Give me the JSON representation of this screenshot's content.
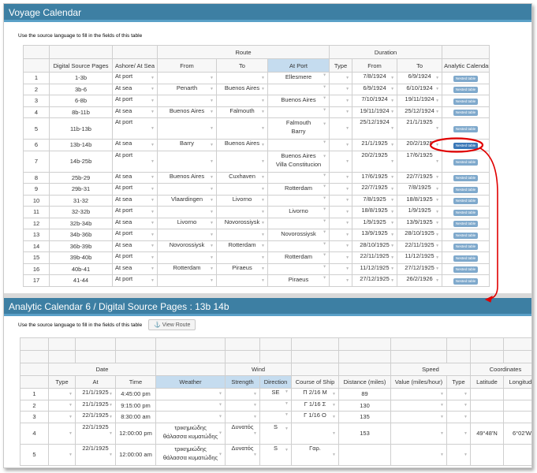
{
  "voyage": {
    "title": "Voyage Calendar",
    "note": "Use the source language to fill in the fields of this table",
    "group_headers": {
      "route": "Route",
      "duration": "Duration"
    },
    "col_headers": [
      "",
      "Digital Source Pages",
      "Ashore/ At Sea",
      "From",
      "To",
      "At Port",
      "Type",
      "From",
      "To",
      "Analytic Calendar"
    ],
    "nested_label": "Nested table",
    "rows": [
      {
        "n": "1",
        "pages": "1-3b",
        "ashore": "At port",
        "from": "",
        "to": "",
        "port": "Ellesmere",
        "dfrom": "7/8/1924",
        "dto": "6/9/1924"
      },
      {
        "n": "2",
        "pages": "3b-6",
        "ashore": "At sea",
        "from": "Penarth",
        "to": "Buenos Aires",
        "port": "",
        "dfrom": "6/9/1924",
        "dto": "6/10/1924"
      },
      {
        "n": "3",
        "pages": "6-8b",
        "ashore": "At port",
        "from": "",
        "to": "",
        "port": "Buenos Aires",
        "dfrom": "7/10/1924",
        "dto": "19/11/1924"
      },
      {
        "n": "4",
        "pages": "8b-11b",
        "ashore": "At sea",
        "from": "Buenos Aires",
        "to": "Falmouth",
        "port": "",
        "dfrom": "19/11/1924",
        "dto": "25/12/1924"
      },
      {
        "n": "5",
        "pages": "11b-13b",
        "ashore": "At port",
        "from": "",
        "to": "",
        "port": "Falmouth",
        "port2": "Barry",
        "dfrom": "25/12/1924",
        "dto": "21/1/1925"
      },
      {
        "n": "6",
        "pages": "13b-14b",
        "ashore": "At sea",
        "from": "Barry",
        "to": "Buenos Aires",
        "port": "",
        "dfrom": "21/1/1925",
        "dto": "20/2/1925",
        "active": true
      },
      {
        "n": "7",
        "pages": "14b-25b",
        "ashore": "At port",
        "from": "",
        "to": "",
        "port": "Buenos Aires",
        "port2": "Villa Constitucion",
        "dfrom": "20/2/1925",
        "dto": "17/6/1925"
      },
      {
        "n": "8",
        "pages": "25b-29",
        "ashore": "At sea",
        "from": "Buenos Aires",
        "to": "Cuxhaven",
        "port": "",
        "dfrom": "17/6/1925",
        "dto": "22/7/1925"
      },
      {
        "n": "9",
        "pages": "29b-31",
        "ashore": "At port",
        "from": "",
        "to": "",
        "port": "Rotterdam",
        "dfrom": "22/7/1925",
        "dto": "7/8/1925"
      },
      {
        "n": "10",
        "pages": "31-32",
        "ashore": "At sea",
        "from": "Vlaardingen",
        "to": "Livorno",
        "port": "",
        "dfrom": "7/8/1925",
        "dto": "18/8/1925"
      },
      {
        "n": "11",
        "pages": "32-32b",
        "ashore": "At port",
        "from": "",
        "to": "",
        "port": "Livorno",
        "dfrom": "18/8/1925",
        "dto": "1/9/1925"
      },
      {
        "n": "12",
        "pages": "32b-34b",
        "ashore": "At sea",
        "from": "Livorno",
        "to": "Novorossiysk",
        "port": "",
        "dfrom": "1/9/1925",
        "dto": "13/9/1925"
      },
      {
        "n": "13",
        "pages": "34b-36b",
        "ashore": "At port",
        "from": "",
        "to": "",
        "port": "Novorossiysk",
        "dfrom": "13/9/1925",
        "dto": "28/10/1925"
      },
      {
        "n": "14",
        "pages": "36b-39b",
        "ashore": "At sea",
        "from": "Novorossiysk",
        "to": "Rotterdam",
        "port": "",
        "dfrom": "28/10/1925",
        "dto": "22/11/1925"
      },
      {
        "n": "15",
        "pages": "39b-40b",
        "ashore": "At port",
        "from": "",
        "to": "",
        "port": "Rotterdam",
        "dfrom": "22/11/1925",
        "dto": "11/12/1925"
      },
      {
        "n": "16",
        "pages": "40b-41",
        "ashore": "At sea",
        "from": "Rotterdam",
        "to": "Piraeus",
        "port": "",
        "dfrom": "11/12/1925",
        "dto": "27/12/1925"
      },
      {
        "n": "17",
        "pages": "41-44",
        "ashore": "At port",
        "from": "",
        "to": "",
        "port": "Piraeus",
        "dfrom": "27/12/1925",
        "dto": "26/2/1926"
      }
    ]
  },
  "analytic": {
    "title": "Analytic Calendar 6 / Digital Source Pages : 13b 14b",
    "note": "Use the source language to fill in the fields of this table",
    "view_route": "View Route",
    "group_headers": {
      "date": "Date",
      "wind": "Wind",
      "speed": "Speed",
      "coords": "Coordinates"
    },
    "col_headers": [
      "",
      "Type",
      "At",
      "Time",
      "Weather",
      "Strength",
      "Direction",
      "Course of Ship",
      "Distance (miles)",
      "Value (miles/hour)",
      "Type",
      "Latitude",
      "Longitude"
    ],
    "rows": [
      {
        "n": "1",
        "at": "21/1/1925",
        "time": "4:45:00 pm",
        "weather": "",
        "strength": "",
        "dir": "SE",
        "course": "Π 2/16 Μ",
        "dist": "89",
        "lat": "",
        "lon": ""
      },
      {
        "n": "2",
        "at": "21/1/1925",
        "time": "9:15:00 pm",
        "weather": "",
        "strength": "",
        "dir": "",
        "course": "Γ 1/16 Σ",
        "dist": "130",
        "lat": "",
        "lon": ""
      },
      {
        "n": "3",
        "at": "22/1/1925",
        "time": "8:30:00 am",
        "weather": "",
        "strength": "",
        "dir": "",
        "course": "Γ 1/16 Ο",
        "dist": "135",
        "lat": "",
        "lon": ""
      },
      {
        "n": "4",
        "at": "22/1/1925",
        "time": "12:00:00 pm",
        "weather": "τρικημιώδης",
        "weather2": "θάλασσα κυματώδης",
        "strength": "Δυνατός",
        "dir": "S",
        "course": "",
        "dist": "153",
        "lat": "49°48'N",
        "lon": "6°02'W"
      },
      {
        "n": "5",
        "at": "22/1/1925",
        "time": "12:00:00 am",
        "weather": "τρικημιώδης",
        "weather2": "θάλασσα κυματώδης",
        "strength": "Δυνατός",
        "dir": "S",
        "course": "Γαρ.",
        "dist": "",
        "lat": "",
        "lon": ""
      }
    ]
  },
  "colors": {
    "header_bg": "#3d7fa3",
    "highlight": "#c5dcef",
    "annotation": "#e00000",
    "nested_btn": "#7fa9cc"
  }
}
